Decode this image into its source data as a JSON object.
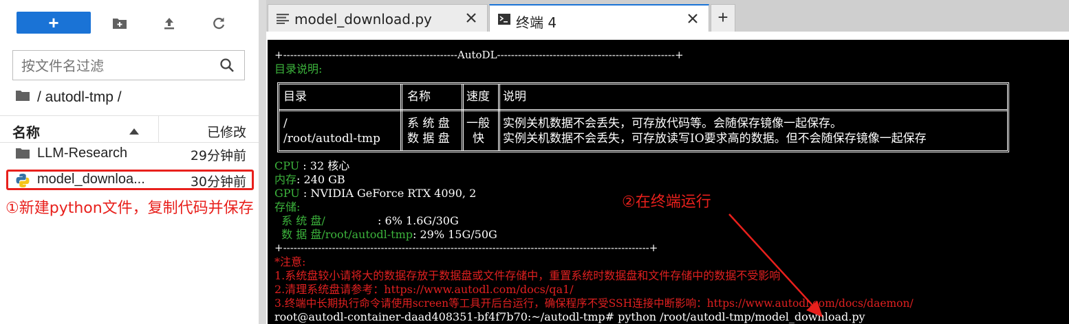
{
  "toolbar": {
    "new_label": "+",
    "icons": [
      "new-folder-icon",
      "upload-icon",
      "refresh-icon"
    ]
  },
  "filebrowser": {
    "search_placeholder": "按文件名过滤",
    "breadcrumb": "/ autodl-tmp /",
    "col_name": "名称",
    "col_modified": "已修改",
    "files": [
      {
        "name": "LLM-Research",
        "time": "29分钟前",
        "icon": "folder-icon"
      },
      {
        "name": "model_download.py",
        "display": "model_downloa...",
        "time": "30分钟前",
        "icon": "python-icon"
      }
    ]
  },
  "annotations": {
    "step1": "①新建python文件，复制代码并保存",
    "step2": "②在终端运行",
    "color": "#e8201c"
  },
  "tabs": [
    {
      "label": "model_download.py",
      "icon": "text-file-icon",
      "active": false
    },
    {
      "label": "终端 4",
      "icon": "terminal-icon",
      "active": true
    }
  ],
  "add_tab_label": "+",
  "terminal": {
    "banner": "+--------------------------------------------------AutoDL---------------------------------------------------+",
    "dir_title": "目录说明:",
    "table": {
      "h_dir": "目录",
      "h_name": "名称",
      "h_speed": "速度",
      "h_desc": "说明",
      "dir1": "/",
      "dir2": "/root/autodl-tmp",
      "name1": "系 统 盘",
      "name2": "数 据 盘",
      "speed1": "一般",
      "speed2": "快",
      "desc1": "实例关机数据不会丢失，可存放代码等。会随保存镜像一起保存。",
      "desc2": "实例关机数据不会丢失，可存放读写IO要求高的数据。但不会随保存镜像一起保存"
    },
    "cpu_label": "CPU ",
    "cpu_value": ": 32 核心",
    "mem_label": "内存",
    "mem_value": ": 240 GB",
    "gpu_label": "GPU ",
    "gpu_value": ": NVIDIA GeForce RTX 4090, 2",
    "storage_label": "存储:",
    "sys_disk_label": "  系 统 盘/               ",
    "sys_disk_value": ": 6% 1.6G/30G",
    "data_disk_label": "  数 据 盘/root/autodl-tmp",
    "data_disk_value": ": 29% 15G/50G",
    "divider": "+---------------------------------------------------------------------------------------------------------+",
    "notice_title": "*注意:",
    "notice1": "1.系统盘较小请将大的数据存放于数据盘或文件存储中，重置系统时数据盘和文件存储中的数据不受影响",
    "notice2": "2.清理系统盘请参考：https://www.autodl.com/docs/qa1/",
    "notice3": "3.终端中长期执行命令请使用screen等工具开后台运行，确保程序不受SSH连接中断影响：https://www.autodl.com/docs/daemon/",
    "prompt": "root@autodl-container-daad408351-bf4f7b70:~/autodl-tmp# python /root/autodl-tmp/model_download.py"
  }
}
